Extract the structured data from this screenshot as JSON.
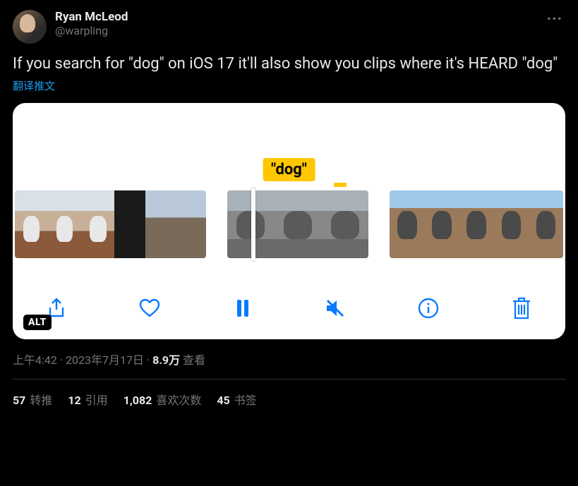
{
  "author": {
    "display_name": "Ryan McLeod",
    "handle": "@warpling"
  },
  "tweet_text": "If you search for \"dog\" on iOS 17 it'll also show you clips where it's HEARD \"dog\"",
  "translate_label": "翻译推文",
  "media": {
    "caption_tag": "\"dog\"",
    "alt_badge": "ALT"
  },
  "meta": {
    "time": "上午4:42",
    "date": "2023年7月17日",
    "views_count": "8.9万",
    "views_label": "查看"
  },
  "stats": {
    "retweets_count": "57",
    "retweets_label": "转推",
    "quotes_count": "12",
    "quotes_label": "引用",
    "likes_count": "1,082",
    "likes_label": "喜欢次数",
    "bookmarks_count": "45",
    "bookmarks_label": "书签"
  }
}
